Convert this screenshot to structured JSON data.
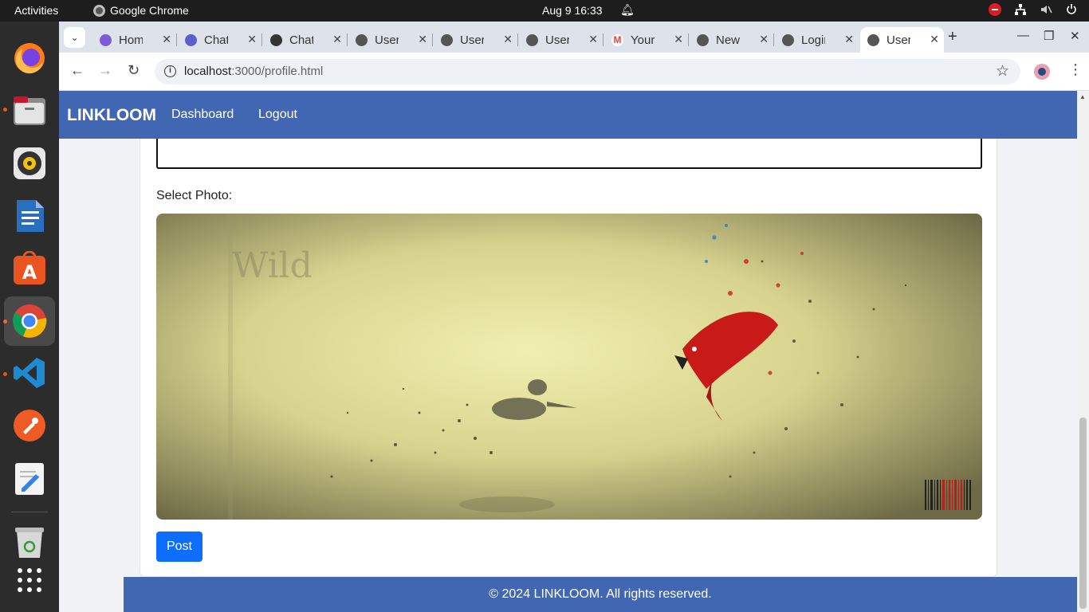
{
  "topbar": {
    "activities": "Activities",
    "app_name": "Google Chrome",
    "clock": "Aug 9  16:33"
  },
  "dock": {
    "apps": [
      "firefox-icon",
      "files-icon",
      "rhythmbox-icon",
      "libreoffice-writer-icon",
      "app-center-icon",
      "chrome-icon",
      "vscode-icon",
      "postman-icon",
      "text-editor-icon",
      "trash-icon",
      "app-grid-icon"
    ]
  },
  "browser": {
    "tabs": [
      {
        "label": "Home",
        "icon": "copilot-icon",
        "color": "#7b5cd6"
      },
      {
        "label": "Chat",
        "icon": "teams-icon",
        "color": "#5b5fc7"
      },
      {
        "label": "ChatGPT",
        "icon": "openai-icon",
        "color": "#333333"
      },
      {
        "label": "User",
        "icon": "globe-icon",
        "color": "#555555"
      },
      {
        "label": "User",
        "icon": "globe-icon",
        "color": "#555555"
      },
      {
        "label": "User",
        "icon": "globe-icon",
        "color": "#555555"
      },
      {
        "label": "Your",
        "icon": "gmail-icon",
        "color": "#ea4335"
      },
      {
        "label": "New",
        "icon": "globe-icon",
        "color": "#555555"
      },
      {
        "label": "Login",
        "icon": "globe-icon",
        "color": "#555555"
      },
      {
        "label": "User",
        "icon": "globe-icon",
        "color": "#555555"
      }
    ],
    "active_tab": 9,
    "url_host": "localhost",
    "url_path": ":3000/profile.html"
  },
  "site": {
    "brand": "LINKLOOM",
    "nav": [
      "Dashboard",
      "Logout"
    ],
    "select_photo_label": "Select Photo:",
    "post_button": "Post",
    "photo_watermark": "Wild",
    "footer": "© 2024 LINKLOOM. All rights reserved.",
    "brand_color": "#4267b2",
    "button_color": "#0d6efd"
  }
}
